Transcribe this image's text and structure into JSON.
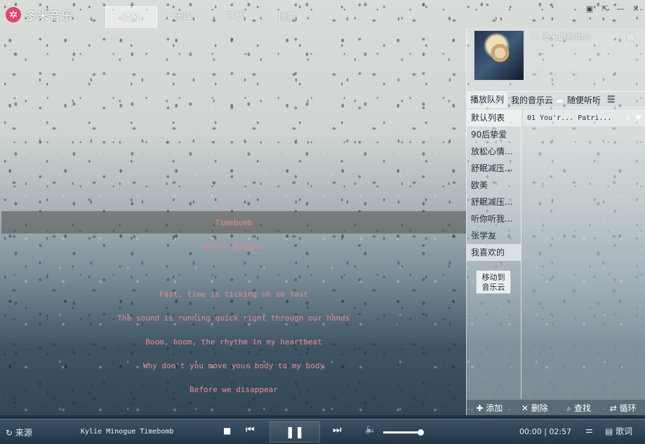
{
  "app": {
    "logo_text": "多米音乐",
    "logo_glyph": "✲"
  },
  "tabs": [
    {
      "label": "播放"
    },
    {
      "label": "乐库"
    },
    {
      "label": "下载"
    },
    {
      "label": "搜索"
    }
  ],
  "window_controls": [
    "▣",
    "⇱",
    "—",
    "✕"
  ],
  "lyrics": [
    "Timebomb",
    "Kylie Minogue",
    "Fast, time is ticking oh so fast",
    "The sound is running quick right through our hands",
    "Boom, boom, the rhythm in my heartbeat",
    "Why don't you move your body to my body",
    "Before we disappear"
  ],
  "right_panel": {
    "radio_label": "多米最热电台",
    "sub_tabs": [
      "播放队列",
      "我的音乐云",
      "随便听听"
    ],
    "playlists_header": "默认列表",
    "playlists": [
      "90后挚爱",
      "放松心情...",
      "舒眠减压...",
      "欧美",
      "舒眠减压...",
      "听你听我...",
      "张学友",
      "我喜欢的"
    ],
    "move_button": [
      "移动到",
      "音乐云"
    ],
    "song_row": "01 You'r... Patri...",
    "list_actions": [
      "添加",
      "删除",
      "查找",
      "循环"
    ]
  },
  "player": {
    "source_label": "来源",
    "now_playing": "Kylie Minogue Timebomb",
    "elapsed": "00:00",
    "duration": "02:57",
    "lyrics_label": "歌词",
    "progress": 0.0,
    "volume": 0.95
  },
  "colors": {
    "lyric": "#e0808a",
    "logo_badge": "#e2446a",
    "player_bar": "#2d4356"
  }
}
